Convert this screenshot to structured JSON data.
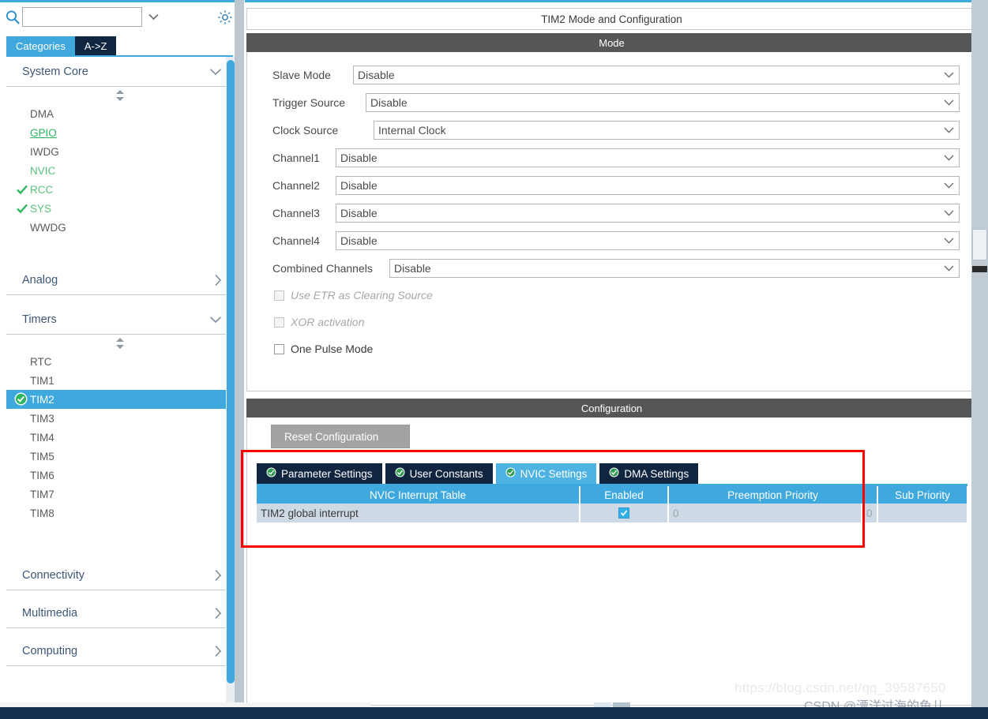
{
  "sidebar": {
    "search": {
      "value": "",
      "placeholder": "",
      "icon": "search-icon"
    },
    "settings_icon": "gear-icon",
    "tabs": [
      {
        "label": "Categories",
        "active": true
      },
      {
        "label": "A->Z",
        "active": false
      }
    ],
    "groups": [
      {
        "title": "System Core",
        "expanded": true,
        "items": [
          {
            "label": "DMA",
            "state": "normal",
            "mark": "none"
          },
          {
            "label": "GPIO",
            "state": "configured-link",
            "mark": "none"
          },
          {
            "label": "IWDG",
            "state": "normal",
            "mark": "none"
          },
          {
            "label": "NVIC",
            "state": "configured",
            "mark": "none"
          },
          {
            "label": "RCC",
            "state": "configured",
            "mark": "check"
          },
          {
            "label": "SYS",
            "state": "configured",
            "mark": "check"
          },
          {
            "label": "WWDG",
            "state": "normal",
            "mark": "none"
          }
        ]
      },
      {
        "title": "Analog",
        "expanded": false,
        "items": []
      },
      {
        "title": "Timers",
        "expanded": true,
        "items": [
          {
            "label": "RTC",
            "state": "normal",
            "mark": "none"
          },
          {
            "label": "TIM1",
            "state": "normal",
            "mark": "none"
          },
          {
            "label": "TIM2",
            "state": "selected",
            "mark": "check-circle"
          },
          {
            "label": "TIM3",
            "state": "normal",
            "mark": "none"
          },
          {
            "label": "TIM4",
            "state": "normal",
            "mark": "none"
          },
          {
            "label": "TIM5",
            "state": "normal",
            "mark": "none"
          },
          {
            "label": "TIM6",
            "state": "normal",
            "mark": "none"
          },
          {
            "label": "TIM7",
            "state": "normal",
            "mark": "none"
          },
          {
            "label": "TIM8",
            "state": "normal",
            "mark": "none"
          }
        ]
      },
      {
        "title": "Connectivity",
        "expanded": false,
        "items": []
      },
      {
        "title": "Multimedia",
        "expanded": false,
        "items": []
      },
      {
        "title": "Computing",
        "expanded": false,
        "items": []
      }
    ]
  },
  "main": {
    "panel_title": "TIM2 Mode and Configuration",
    "mode_section_title": "Mode",
    "config_section_title": "Configuration",
    "mode_fields": [
      {
        "label": "Slave Mode",
        "value": "Disable",
        "label_width": 102
      },
      {
        "label": "Trigger Source",
        "value": "Disable",
        "label_width": 118
      },
      {
        "label": "Clock Source",
        "value": "Internal Clock",
        "label_width": 128
      },
      {
        "label": "Channel1",
        "value": "Disable",
        "label_width": 80
      },
      {
        "label": "Channel2",
        "value": "Disable",
        "label_width": 80
      },
      {
        "label": "Channel3",
        "value": "Disable",
        "label_width": 80
      },
      {
        "label": "Channel4",
        "value": "Disable",
        "label_width": 80
      },
      {
        "label": "Combined Channels",
        "value": "Disable",
        "label_width": 148
      }
    ],
    "mode_checkboxes": [
      {
        "label": "Use ETR as Clearing Source",
        "checked": false,
        "enabled": false
      },
      {
        "label": "XOR activation",
        "checked": false,
        "enabled": false
      },
      {
        "label": "One Pulse Mode",
        "checked": false,
        "enabled": true
      }
    ],
    "reset_button": "Reset Configuration",
    "config_tabs": [
      {
        "label": "Parameter Settings",
        "active": false,
        "icon": "check-circle-icon"
      },
      {
        "label": "User Constants",
        "active": false,
        "icon": "check-circle-icon"
      },
      {
        "label": "NVIC Settings",
        "active": true,
        "icon": "check-circle-icon"
      },
      {
        "label": "DMA Settings",
        "active": false,
        "icon": "check-circle-icon"
      }
    ],
    "nvic_table": {
      "columns": [
        "NVIC Interrupt Table",
        "Enabled",
        "Preemption Priority",
        "Sub Priority"
      ],
      "rows": [
        {
          "interrupt": "TIM2 global interrupt",
          "enabled": true,
          "preemption_priority": "0",
          "sub_priority": "0"
        }
      ]
    }
  },
  "watermark": {
    "url": "https://blog.csdn.net/qq_39587650",
    "credit": "CSDN @漂洋过海的鱼儿"
  },
  "colors": {
    "accent_blue": "#3fa9dd",
    "tab_dark": "#10253f",
    "section_gray": "#565656",
    "highlight_red": "#ff0000",
    "status_bar": "#15304e",
    "green_check": "#2fb45f"
  }
}
